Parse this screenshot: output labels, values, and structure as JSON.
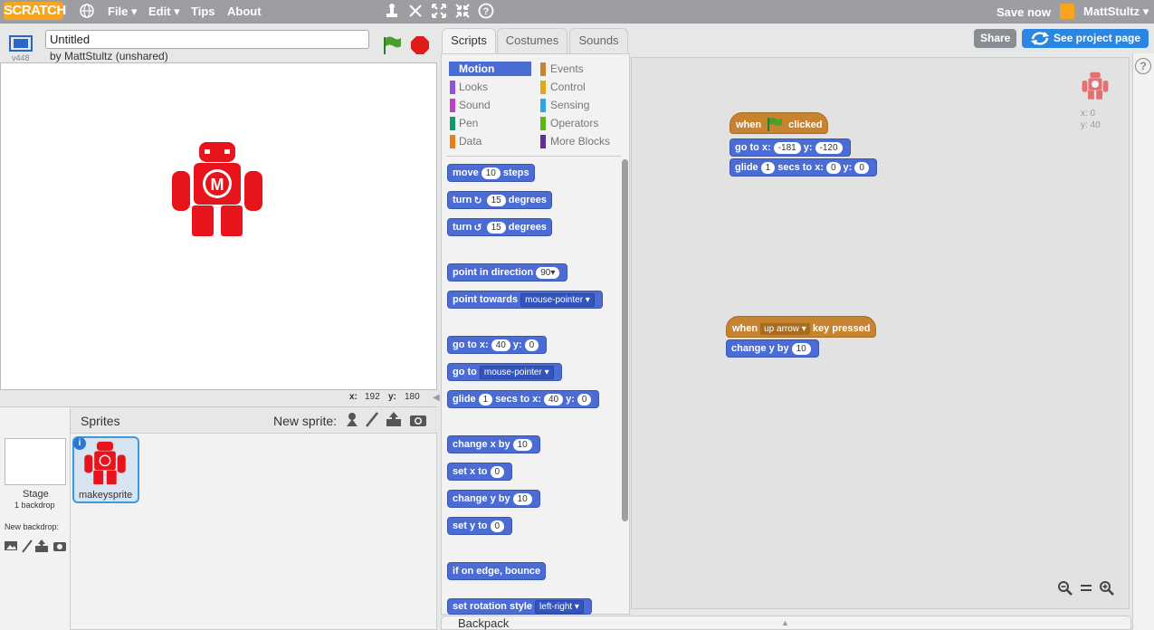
{
  "menubar": {
    "logo": "SCRATCH",
    "items": [
      "File ▾",
      "Edit ▾",
      "Tips",
      "About"
    ],
    "save_now": "Save now",
    "user": "MattStultz ▾"
  },
  "stage": {
    "version": "v448",
    "title_value": "Untitled",
    "owner": "by MattStultz (unshared)",
    "mouse_x_label": "x:",
    "mouse_x": "192",
    "mouse_y_label": "y:",
    "mouse_y": "180",
    "sprite_letter": "M"
  },
  "sprites": {
    "header": "Sprites",
    "new_sprite": "New sprite:",
    "stage_label": "Stage",
    "stage_backdrops": "1 backdrop",
    "new_backdrop": "New backdrop:",
    "sprite_name": "makeysprite",
    "info": "i"
  },
  "tabs": [
    "Scripts",
    "Costumes",
    "Sounds"
  ],
  "categories": [
    {
      "label": "Motion",
      "color": "#4a6cd4"
    },
    {
      "label": "Events",
      "color": "#c88330"
    },
    {
      "label": "Looks",
      "color": "#8a55d7"
    },
    {
      "label": "Control",
      "color": "#e1a91a"
    },
    {
      "label": "Sound",
      "color": "#bb42c3"
    },
    {
      "label": "Sensing",
      "color": "#2ca5e2"
    },
    {
      "label": "Pen",
      "color": "#0e9a6c"
    },
    {
      "label": "Operators",
      "color": "#5cb712"
    },
    {
      "label": "Data",
      "color": "#ee7d16"
    },
    {
      "label": "More Blocks",
      "color": "#632d99"
    }
  ],
  "palette": {
    "move": [
      "move",
      "10",
      "steps"
    ],
    "turn_right": [
      "turn",
      "15",
      "degrees"
    ],
    "turn_left": [
      "turn",
      "15",
      "degrees"
    ],
    "point_dir": [
      "point in direction",
      "90▾"
    ],
    "point_towards": [
      "point towards",
      "mouse-pointer ▾"
    ],
    "goto_xy": [
      "go to x:",
      "40",
      "y:",
      "0"
    ],
    "goto": [
      "go to",
      "mouse-pointer ▾"
    ],
    "glide": [
      "glide",
      "1",
      "secs to x:",
      "40",
      "y:",
      "0"
    ],
    "change_x": [
      "change x by",
      "10"
    ],
    "set_x": [
      "set x to",
      "0"
    ],
    "change_y": [
      "change y by",
      "10"
    ],
    "set_y": [
      "set y to",
      "0"
    ],
    "bounce": "if on edge, bounce",
    "rotation": [
      "set rotation style",
      "left-right ▾"
    ]
  },
  "topbuttons": {
    "share": "Share",
    "project_page": "See project page"
  },
  "scripts": {
    "help": "?",
    "flag_hat": [
      "when",
      "clicked"
    ],
    "goto": [
      "go to x:",
      "-181",
      "y:",
      "-120"
    ],
    "glide": [
      "glide",
      "1",
      "secs to x:",
      "0",
      "y:",
      "0"
    ],
    "key_hat": [
      "when",
      "up arrow ▾",
      "key pressed"
    ],
    "change_y": [
      "change y by",
      "10"
    ],
    "sprite_x": "x: 0",
    "sprite_y": "y: 40"
  },
  "backpack": "Backpack"
}
